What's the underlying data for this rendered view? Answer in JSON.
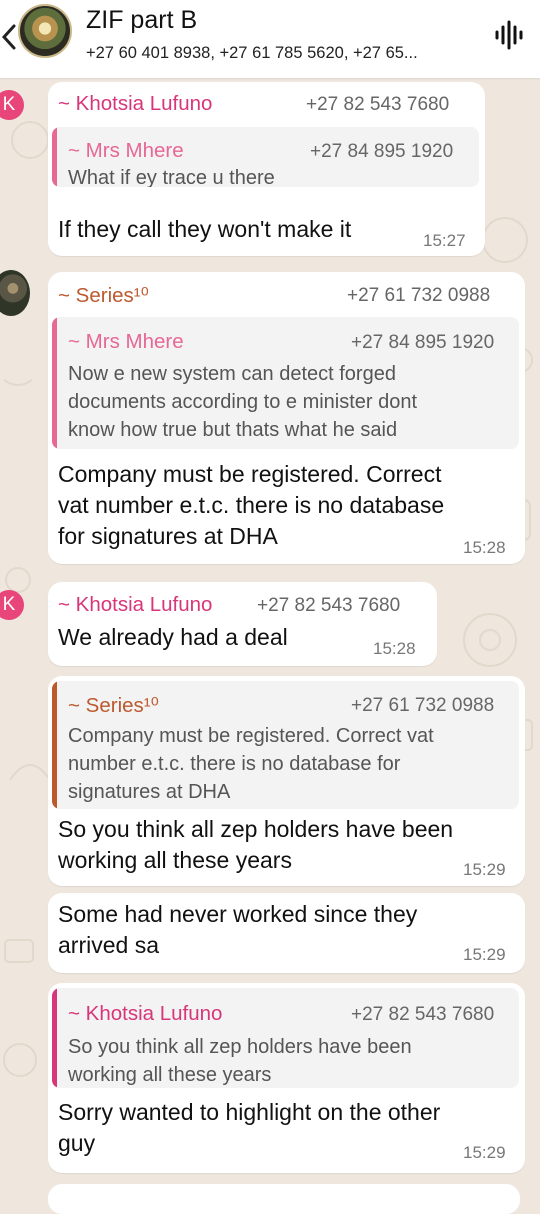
{
  "header": {
    "title": "ZIF part B",
    "participants": "+27 60 401 8938, +27 61 785 5620, +27 65..."
  },
  "colors": {
    "accent_pink": "#d8367a",
    "accent_orange": "#bc5a2e",
    "bubble": "#ffffff",
    "background": "#efe7de"
  },
  "messages": [
    {
      "avatar_letter": "K",
      "sender": "~ Khotsia Lufuno",
      "phone": "+27 82 543 7680",
      "quote": {
        "sender": "~ Mrs Mhere",
        "phone": "+27 84 895 1920",
        "lines": [
          "What if ey trace u there"
        ]
      },
      "lines": [
        "If they call they won't make it"
      ],
      "time": "15:27"
    },
    {
      "sender": "~ Series¹⁰",
      "phone": "+27 61 732 0988",
      "quote": {
        "sender": "~ Mrs Mhere",
        "phone": "+27 84 895 1920",
        "lines": [
          "Now e new system can detect forged",
          "documents according to  e minister dont",
          "know how true but thats what he said"
        ]
      },
      "lines": [
        "Company must be registered. Correct",
        "vat number e.t.c. there is no database",
        "for signatures at DHA"
      ],
      "time": "15:28"
    },
    {
      "avatar_letter": "K",
      "sender": "~ Khotsia Lufuno",
      "phone": "+27 82 543 7680",
      "lines": [
        "We already had a deal"
      ],
      "time": "15:28"
    },
    {
      "quote": {
        "sender": "~ Series¹⁰",
        "phone": "+27 61 732 0988",
        "lines": [
          "Company must be registered. Correct vat",
          "number e.t.c. there is no database for",
          "signatures at DHA"
        ]
      },
      "lines": [
        "So you think all zep holders have been",
        "working all these  years"
      ],
      "time": "15:29"
    },
    {
      "lines": [
        "Some had never worked since they",
        "arrived sa"
      ],
      "time": "15:29"
    },
    {
      "quote": {
        "sender": "~ Khotsia Lufuno",
        "phone": "+27 82 543 7680",
        "lines": [
          "So you think all zep holders have been",
          "working all these  years"
        ]
      },
      "lines": [
        "Sorry wanted to highlight on the other",
        "guy"
      ],
      "time": "15:29"
    }
  ]
}
